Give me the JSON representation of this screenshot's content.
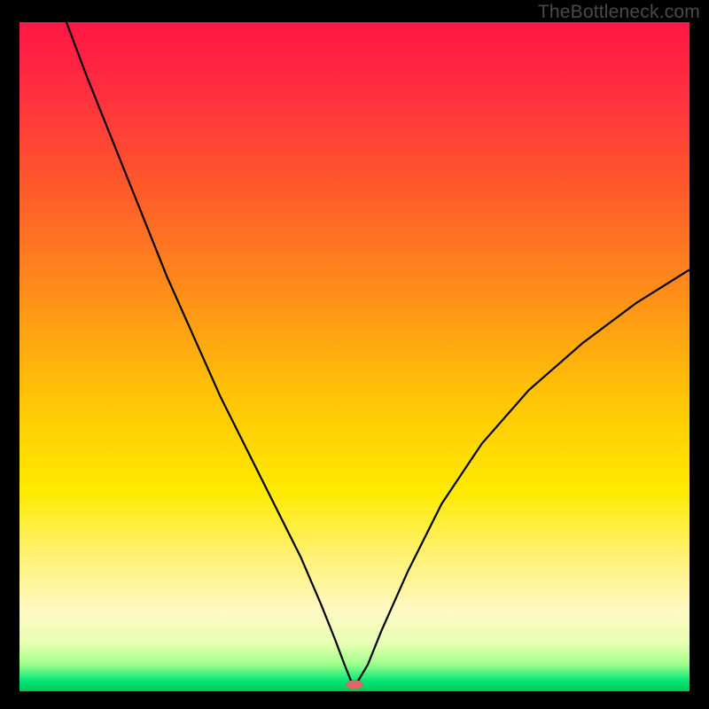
{
  "watermark": "TheBottleneck.com",
  "chart_data": {
    "type": "line",
    "title": "",
    "xlabel": "",
    "ylabel": "",
    "xlim": [
      0,
      100
    ],
    "ylim": [
      0,
      100
    ],
    "background_gradient": {
      "stops": [
        {
          "offset": 0.0,
          "color": "#ff1744"
        },
        {
          "offset": 0.1,
          "color": "#ff2e3f"
        },
        {
          "offset": 0.25,
          "color": "#ff5a2a"
        },
        {
          "offset": 0.4,
          "color": "#ff8c1a"
        },
        {
          "offset": 0.55,
          "color": "#ffc107"
        },
        {
          "offset": 0.7,
          "color": "#ffea00"
        },
        {
          "offset": 0.8,
          "color": "#fff176"
        },
        {
          "offset": 0.88,
          "color": "#fff9c4"
        },
        {
          "offset": 0.93,
          "color": "#e6ffb2"
        },
        {
          "offset": 0.96,
          "color": "#9cff8a"
        },
        {
          "offset": 0.985,
          "color": "#00e676"
        },
        {
          "offset": 1.0,
          "color": "#00c853"
        }
      ]
    },
    "series": [
      {
        "name": "bottleneck-curve",
        "x": [
          7,
          10,
          14,
          18,
          22,
          26,
          30,
          34,
          38,
          42,
          45,
          47,
          48.5,
          49.5,
          50.5,
          52,
          54,
          58,
          63,
          69,
          76,
          84,
          92,
          100
        ],
        "y": [
          100,
          92,
          82,
          72,
          62,
          53,
          44,
          36,
          28,
          20,
          13,
          8,
          4,
          1.5,
          1.5,
          4,
          9,
          18,
          28,
          37,
          45,
          52,
          58,
          63
        ]
      }
    ],
    "marker": {
      "name": "optimal-point",
      "x": 50,
      "y": 1.0,
      "color": "#d86a6a",
      "rx": 10,
      "ry": 5
    }
  }
}
